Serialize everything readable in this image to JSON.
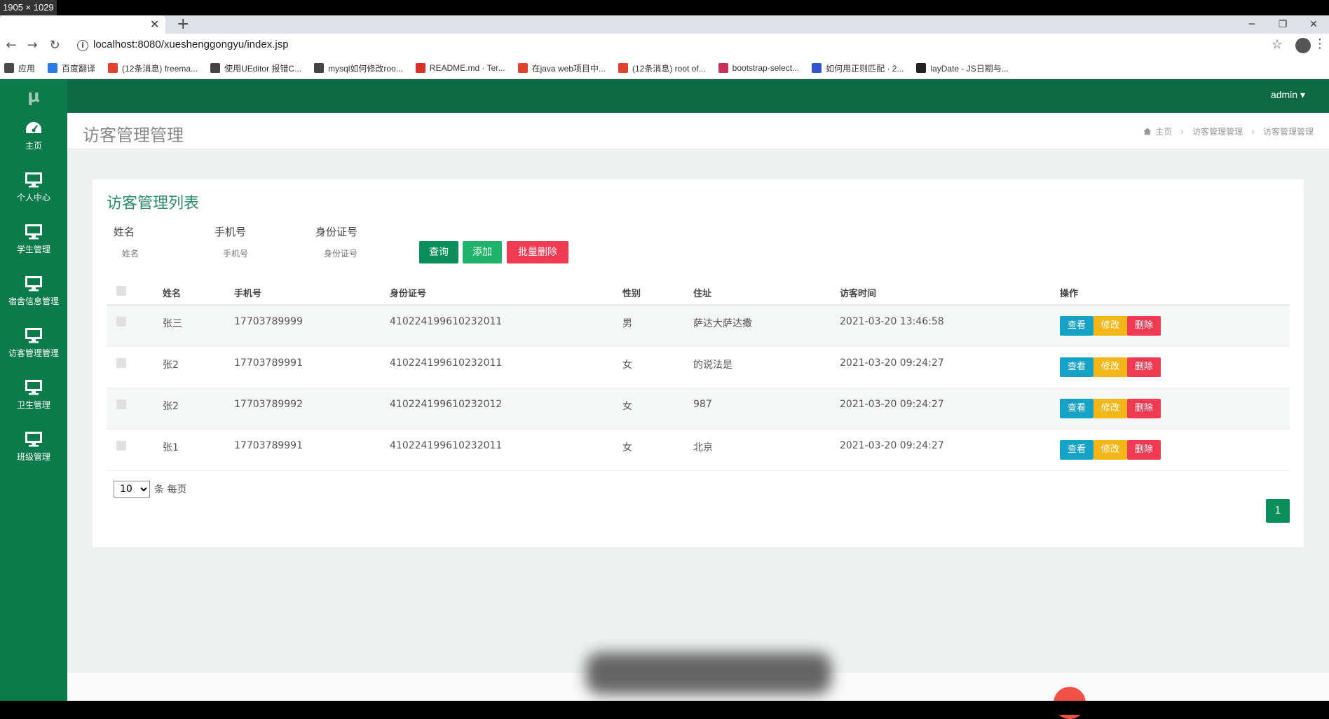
{
  "screen_label": "1905 × 1029",
  "browser": {
    "url": "localhost:8080/xueshenggongyu/index.jsp",
    "bookmarks": [
      {
        "label": "应用",
        "color": "#4a4a4a"
      },
      {
        "label": "百度翻译",
        "color": "#2d7be0"
      },
      {
        "label": "(12条消息) freema...",
        "color": "#e0422f"
      },
      {
        "label": "使用UEditor 报错C...",
        "color": "#444444"
      },
      {
        "label": "mysql如何修改roo...",
        "color": "#444444"
      },
      {
        "label": "README.md · Ter...",
        "color": "#d9302c"
      },
      {
        "label": "在java web项目中...",
        "color": "#e0422f"
      },
      {
        "label": "(12条消息) root of...",
        "color": "#e0422f"
      },
      {
        "label": "bootstrap-select...",
        "color": "#c8325b"
      },
      {
        "label": "如何用正则匹配 · 2...",
        "color": "#3355cc"
      },
      {
        "label": "layDate - JS日期与...",
        "color": "#222222"
      }
    ]
  },
  "app": {
    "logo": "μ",
    "user": "admin ▾",
    "sidebar": [
      {
        "label": "主页",
        "icon": "dashboard-icon"
      },
      {
        "label": "个人中心",
        "icon": "monitor-icon"
      },
      {
        "label": "学生管理",
        "icon": "monitor-icon"
      },
      {
        "label": "宿舍信息管理",
        "icon": "monitor-icon"
      },
      {
        "label": "访客管理管理",
        "icon": "monitor-icon"
      },
      {
        "label": "卫生管理",
        "icon": "monitor-icon"
      },
      {
        "label": "班级管理",
        "icon": "monitor-icon"
      }
    ],
    "page_title": "访客管理管理",
    "breadcrumb": [
      "主页",
      "访客管理管理",
      "访客管理管理"
    ],
    "panel_title": "访客管理列表",
    "filters": [
      {
        "label": "姓名",
        "placeholder": "姓名"
      },
      {
        "label": "手机号",
        "placeholder": "手机号"
      },
      {
        "label": "身份证号",
        "placeholder": "身份证号"
      }
    ],
    "buttons": {
      "search": "查询",
      "add": "添加",
      "batch_delete": "批量删除"
    },
    "columns": [
      "姓名",
      "手机号",
      "身份证号",
      "性别",
      "住址",
      "访客时间",
      "操作"
    ],
    "rows": [
      {
        "name": "张三",
        "phone": "17703789999",
        "id": "410224199610232011",
        "gender": "男",
        "address": "萨达大萨达撒",
        "time": "2021-03-20 13:46:58"
      },
      {
        "name": "张2",
        "phone": "17703789991",
        "id": "410224199610232011",
        "gender": "女",
        "address": "的说法是",
        "time": "2021-03-20 09:24:27"
      },
      {
        "name": "张2",
        "phone": "17703789992",
        "id": "410224199610232012",
        "gender": "女",
        "address": "987",
        "time": "2021-03-20 09:24:27"
      },
      {
        "name": "张1",
        "phone": "17703789991",
        "id": "410224199610232011",
        "gender": "女",
        "address": "北京",
        "time": "2021-03-20 09:24:27"
      }
    ],
    "actions": {
      "view": "查看",
      "edit": "修改",
      "delete": "删除"
    },
    "pager": {
      "page_size": "10",
      "per_page_text": "条 每页",
      "current_page": "1"
    }
  }
}
